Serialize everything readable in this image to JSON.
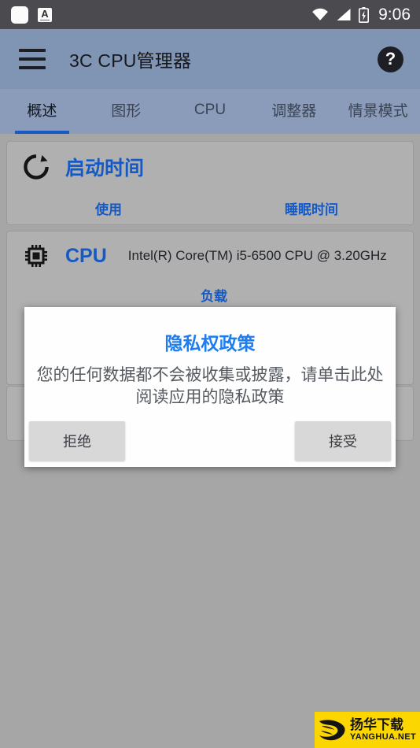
{
  "statusbar": {
    "time": "9:06",
    "icons": [
      "blank-square-icon",
      "keyboard-a-icon",
      "wifi-icon",
      "signal-icon",
      "battery-charging-icon"
    ]
  },
  "appbar": {
    "menu_icon": "hamburger-menu-icon",
    "title": "3C CPU管理器",
    "help_icon": "help-question-icon"
  },
  "tabs": [
    {
      "label": "概述",
      "active": true
    },
    {
      "label": "图形",
      "active": false
    },
    {
      "label": "CPU",
      "active": false
    },
    {
      "label": "调整器",
      "active": false
    },
    {
      "label": "情景模式",
      "active": false
    }
  ],
  "cards": {
    "uptime": {
      "icon": "uptime-refresh-icon",
      "title": "启动时间",
      "metrics": [
        "使用",
        "睡眠时间"
      ]
    },
    "cpu": {
      "icon": "cpu-chip-icon",
      "title": "CPU",
      "detail": "Intel(R) Core(TM) i5-6500 CPU @ 3.20GHz",
      "metric": "负载"
    },
    "third": {
      "icon": "cpu-chip-icon"
    }
  },
  "dialog": {
    "title": "隐私权政策",
    "body": "您的任何数据都不会被收集或披露，请单击此处阅读应用的隐私政策",
    "decline_label": "拒绝",
    "accept_label": "接受"
  },
  "watermark": {
    "logo": "yanghua-bird-logo",
    "name_cn": "扬华下载",
    "name_en": "YANGHUA.NET"
  },
  "colors": {
    "appbar": "#8094b4",
    "tabbar": "#8a9cb9",
    "accent_blue": "#1559c4",
    "dialog_title_blue": "#1d7df0",
    "background": "#a6a6a6",
    "card": "#b0b0b0",
    "statusbar": "#4a4a4f",
    "watermark_yellow": "#fcd601"
  }
}
